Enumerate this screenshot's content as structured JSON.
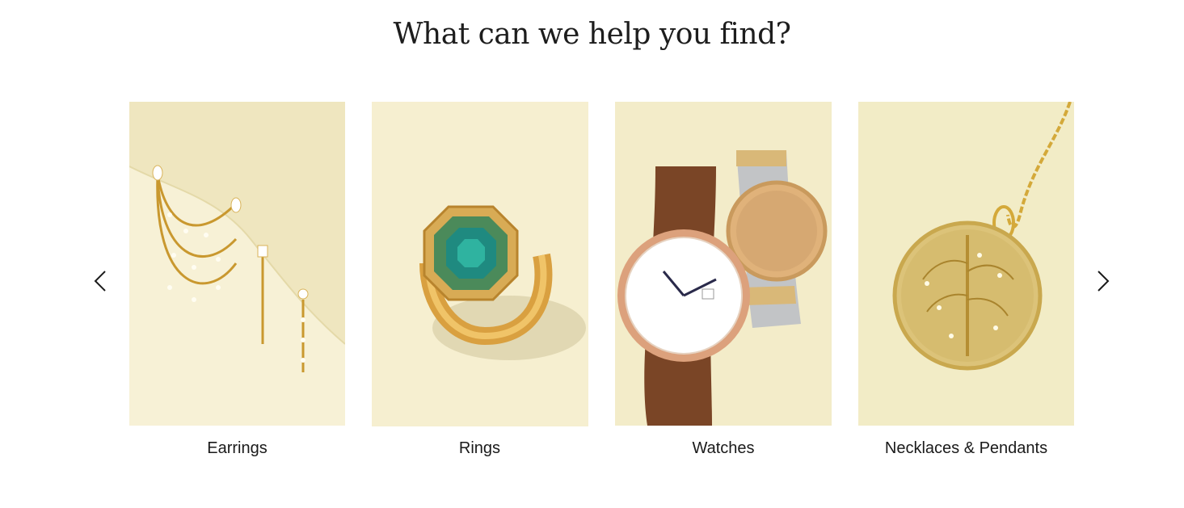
{
  "section": {
    "title": "What can we help you find?"
  },
  "carousel": {
    "prev_icon": "chevron-left-icon",
    "next_icon": "chevron-right-icon",
    "items": [
      {
        "label": "Earrings",
        "image": "gold diamond chain earrings on cream background"
      },
      {
        "label": "Rings",
        "image": "gold ring with green emerald-cut stone"
      },
      {
        "label": "Watches",
        "image": "two wristwatches, brown leather and two-tone steel"
      },
      {
        "label": "Necklaces & Pendants",
        "image": "gold medallion pendant on chain"
      }
    ]
  },
  "colors": {
    "text": "#1a1a1a",
    "background": "#ffffff",
    "card_bg": "#f3ecc8"
  }
}
